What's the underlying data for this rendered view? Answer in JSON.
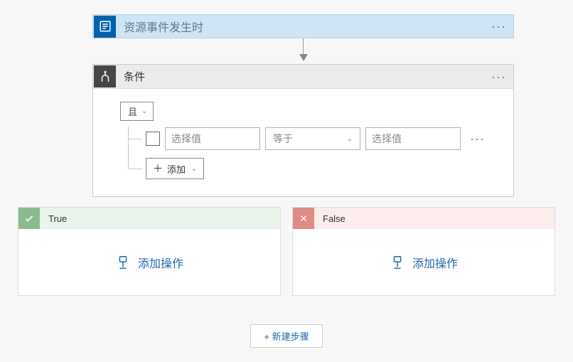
{
  "trigger": {
    "title": "资源事件发生时",
    "icon_name": "azure-resource-icon"
  },
  "condition": {
    "title": "条件",
    "icon_name": "condition-icon",
    "group_operator": "且",
    "row": {
      "left_placeholder": "选择值",
      "operator_label": "等于",
      "right_placeholder": "选择值"
    },
    "add_label": "添加"
  },
  "branches": {
    "true_label": "True",
    "false_label": "False",
    "add_action_label": "添加操作"
  },
  "new_step_label": "+ 新建步骤"
}
